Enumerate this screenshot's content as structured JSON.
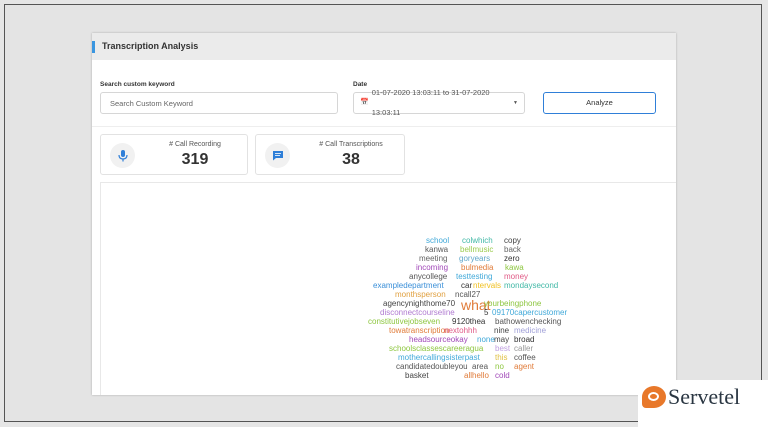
{
  "panel": {
    "title": "Transcription Analysis"
  },
  "search": {
    "label": "Search custom keyword",
    "placeholder": "Search Custom Keyword"
  },
  "date": {
    "label": "Date",
    "value": "01-07-2020 13:03:11 to 31-07-2020 13:03:11"
  },
  "analyze_label": "Analyze",
  "stats": [
    {
      "label": "# Call Recording",
      "value": "319",
      "icon": "microphone-icon"
    },
    {
      "label": "# Call Transcriptions",
      "value": "38",
      "icon": "chat-icon"
    }
  ],
  "word_cloud": [
    {
      "t": "school",
      "c": "#41a9d9"
    },
    {
      "t": "colwhich",
      "c": "#41b8a6"
    },
    {
      "t": "copy",
      "c": "#444444"
    },
    {
      "t": "kanwa",
      "c": "#5a5a5a"
    },
    {
      "t": "bellmusic",
      "c": "#9bcc4e"
    },
    {
      "t": "back",
      "c": "#666666"
    },
    {
      "t": "meeting",
      "c": "#666666"
    },
    {
      "t": "goryears",
      "c": "#5fa6c9"
    },
    {
      "t": "zero",
      "c": "#333333"
    },
    {
      "t": "incoming",
      "c": "#a148b8"
    },
    {
      "t": "bulmedia",
      "c": "#e07b39"
    },
    {
      "t": "kawa",
      "c": "#8dc63f"
    },
    {
      "t": "anycollege",
      "c": "#555555"
    },
    {
      "t": "testtesting",
      "c": "#41a9d9"
    },
    {
      "t": "money",
      "c": "#e05a86"
    },
    {
      "t": "exampledepartment",
      "c": "#3a8fd8"
    },
    {
      "t": "car",
      "c": "#333333"
    },
    {
      "t": "ntervals",
      "c": "#f0c020"
    },
    {
      "t": "mondaysecond",
      "c": "#41b8a6"
    },
    {
      "t": "monthsperson",
      "c": "#e0a040"
    },
    {
      "t": "ncall27",
      "c": "#555555"
    },
    {
      "t": "agencynighthome70",
      "c": "#444444"
    },
    {
      "t": "what",
      "c": "#e07b39"
    },
    {
      "t": "yourbeingphone",
      "c": "#8dc63f"
    },
    {
      "t": "disconnectcourseline",
      "c": "#b07bd1"
    },
    {
      "t": "5",
      "c": "#333333"
    },
    {
      "t": "09170capercustomer",
      "c": "#41a9d9"
    },
    {
      "t": "constitutivejobseven",
      "c": "#8dc63f"
    },
    {
      "t": "9120thea",
      "c": "#333333"
    },
    {
      "t": "bathowenchecking",
      "c": "#555555"
    },
    {
      "t": "towatranscription",
      "c": "#e07b39"
    },
    {
      "t": "nextohhh",
      "c": "#e05a86"
    },
    {
      "t": "nine",
      "c": "#444444"
    },
    {
      "t": "medicine",
      "c": "#a0a0d8"
    },
    {
      "t": "headsourceokay",
      "c": "#a148b8"
    },
    {
      "t": "none",
      "c": "#41a9d9"
    },
    {
      "t": "may",
      "c": "#444444"
    },
    {
      "t": "broad",
      "c": "#333333"
    },
    {
      "t": "schoolsclassescareeragua",
      "c": "#8dc63f"
    },
    {
      "t": "best",
      "c": "#c0a0e0"
    },
    {
      "t": "caller",
      "c": "#999999"
    },
    {
      "t": "mothercallingsisterpast",
      "c": "#41a9d9"
    },
    {
      "t": "this",
      "c": "#e0c040"
    },
    {
      "t": "coffee",
      "c": "#555555"
    },
    {
      "t": "candidatedoubleyou",
      "c": "#555555"
    },
    {
      "t": "area",
      "c": "#555555"
    },
    {
      "t": "no",
      "c": "#8dc63f"
    },
    {
      "t": "agent",
      "c": "#e07b39"
    },
    {
      "t": "basket",
      "c": "#444444"
    },
    {
      "t": "allhello",
      "c": "#e07b39"
    },
    {
      "t": "cold",
      "c": "#a148b8"
    }
  ],
  "brand": {
    "name": "Servetel"
  }
}
